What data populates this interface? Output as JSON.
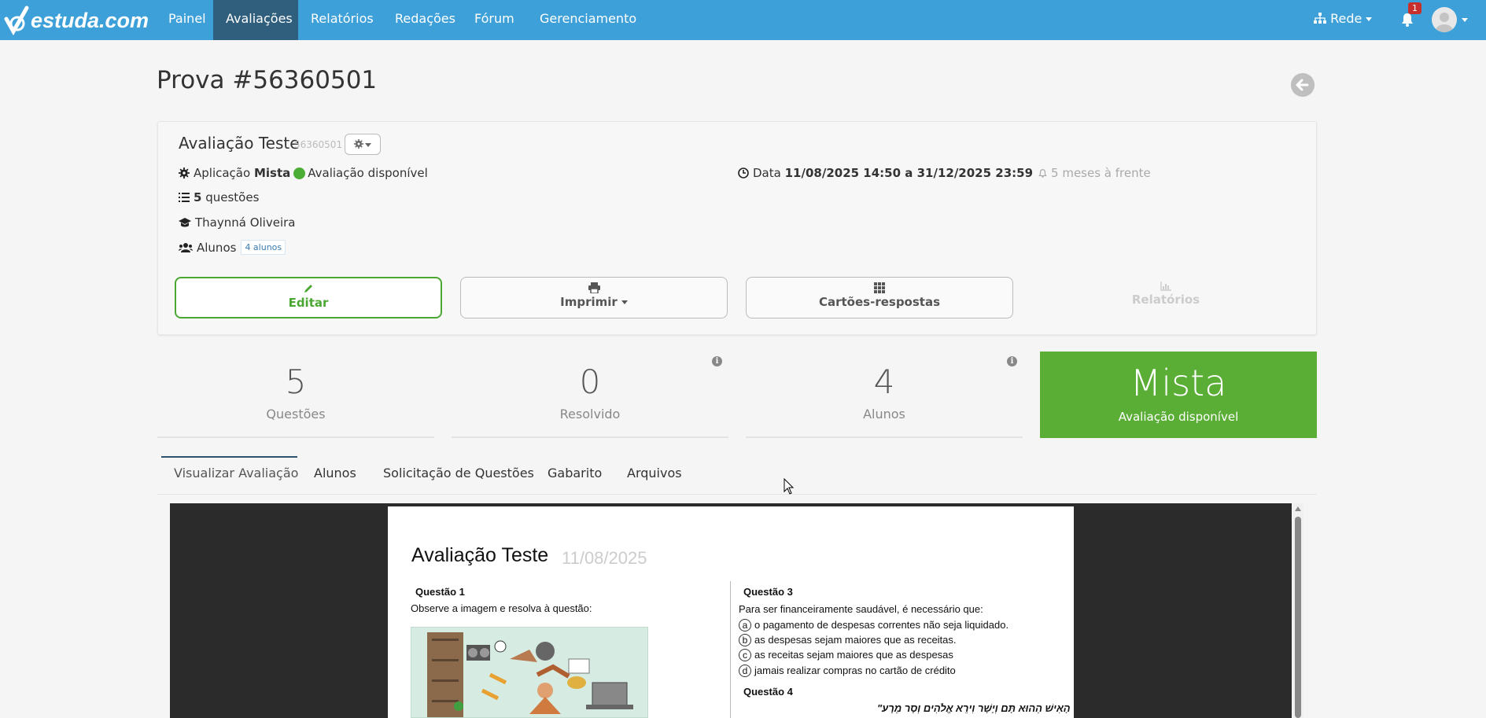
{
  "navbar": {
    "brand": "estuda.com",
    "items": [
      {
        "label": "Painel"
      },
      {
        "label": "Avaliações"
      },
      {
        "label": "Relatórios"
      },
      {
        "label": "Redações"
      },
      {
        "label": "Fórum"
      },
      {
        "label": "Gerenciamento"
      }
    ],
    "active": "Avaliações",
    "network_label": "Rede",
    "notification_count": "1",
    "icons": [
      "sitemap-icon",
      "bell-icon",
      "avatar"
    ]
  },
  "page": {
    "title": "Prova #56360501"
  },
  "assessment": {
    "name": "Avaliação Teste",
    "code": "56360501",
    "application_label": "Aplicação",
    "application_type": "Mista",
    "availability": "Avaliação disponível",
    "questions_count": "5",
    "questions_label": "questões",
    "teacher": "Thaynná Oliveira",
    "students_label": "Alunos",
    "students_badge": "4 alunos",
    "date_label": "Data",
    "date_range": "11/08/2025 14:50 a 31/12/2025 23:59",
    "date_relative": "5 meses à frente"
  },
  "actions": {
    "edit": "Editar",
    "print": "Imprimir",
    "answer_cards": "Cartões-respostas",
    "reports": "Relatórios"
  },
  "stats": [
    {
      "value": "5",
      "label": "Questões"
    },
    {
      "value": "0",
      "label": "Resolvido"
    },
    {
      "value": "4",
      "label": "Alunos"
    }
  ],
  "status_box": {
    "title": "Mista",
    "subtitle": "Avaliação disponível",
    "color": "#5aae36"
  },
  "tabs": [
    {
      "label": "Visualizar Avaliação"
    },
    {
      "label": "Alunos"
    },
    {
      "label": "Solicitação de Questões"
    },
    {
      "label": "Gabarito"
    },
    {
      "label": "Arquivos"
    }
  ],
  "document": {
    "title": "Avaliação Teste",
    "date": "11/08/2025",
    "q1_title": "Questão 1",
    "q1_text": "Observe a imagem e resolva à questão:",
    "q3_title": "Questão 3",
    "q3_text": "Para ser financeiramente saudável, é necessário que:",
    "q3_options": [
      {
        "letter": "a",
        "text": "o pagamento de despesas correntes não seja liquidado."
      },
      {
        "letter": "b",
        "text": "as despesas sejam maiores que as receitas."
      },
      {
        "letter": "c",
        "text": "as receitas sejam maiores que as despesas"
      },
      {
        "letter": "d",
        "text": "jamais realizar compras no cartão de crédito"
      }
    ],
    "q4_title": "Questão 4",
    "q4_text": "הָאִישׁ הַהוּא תָּם וְיָשָׁר וִירֵא אֱלֹהִים וְסָר מֵרָע\""
  },
  "colors": {
    "navbar": "#3ea0d8",
    "nav_active": "#2f5f7c",
    "accent_green": "#4aa832",
    "badge_red": "#c9302c"
  }
}
